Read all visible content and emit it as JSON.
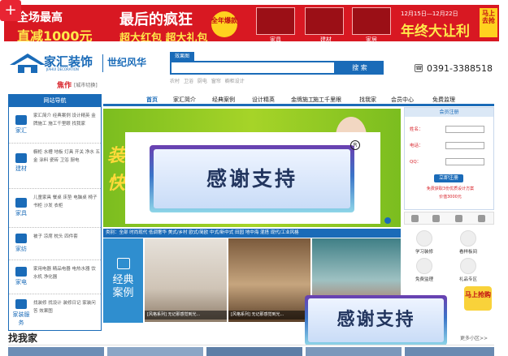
{
  "banner": {
    "left_line1": "全场最高",
    "left_line2": "直减1000元",
    "mid_line1": "最后的疯狂",
    "mid_line2": "超大红包 超大礼包",
    "badge": "全年爆款",
    "products": [
      "家具",
      "建材",
      "家居"
    ],
    "date_range": "12月15日—12月22日",
    "right_text": "年终大让利",
    "tag": "马上去抢"
  },
  "logo": {
    "name": "家汇装饰",
    "en": "JIAHUI DECORATION",
    "slogan": "世纪风华"
  },
  "focus": {
    "label": "焦作",
    "switch": "[城市切换]"
  },
  "search": {
    "tab": "效果图",
    "placeholder": "",
    "button": "搜 索",
    "hot_words": [
      "农村",
      "卫浴",
      "厨电",
      "窗帘",
      "橱柜设计"
    ]
  },
  "phone": "0391-3388518",
  "sidebar": {
    "title": "网站导航",
    "groups": [
      {
        "cat": "家汇",
        "links": "家汇简介 经典案例 设计精英 金牌施工 施工千里眼 找我家"
      },
      {
        "cat": "建材",
        "links": "橱柜 水槽 地板 灯具 开关 净水 五金 涂料 瓷砖 卫浴 厨电"
      },
      {
        "cat": "家具",
        "links": "儿童家具 餐桌 床垫 电脑桌 椅子 书柜 沙发 衣柜"
      },
      {
        "cat": "家纺",
        "links": "被子 凉席 枕头 四件套"
      },
      {
        "cat": "家电",
        "links": "家用电器 精品电器 电热水器 饮水机 净化器"
      },
      {
        "cat": "家装服务",
        "links": "找装修 找设计 装修日记 家装问答 效果图"
      }
    ]
  },
  "nav": {
    "items": [
      "首页",
      "家汇简介",
      "经典案例",
      "设计精英",
      "金牌施工",
      "施工千里眼",
      "找我家",
      "会员中心",
      "免费监理"
    ],
    "right": "免费监理"
  },
  "hero": {
    "word1": "装",
    "word2": "快"
  },
  "ad_overlay": {
    "text": "感谢支持",
    "reg": "R"
  },
  "region": {
    "text": "类别：全部  时尚现代  低调奢华  美式/乡村  欧式/简欧  中式/新中式  田园  地中海  混搭  现代/工业风格"
  },
  "case": {
    "line1": "经典",
    "line2": "案例"
  },
  "photos": [
    {
      "caption": "[风格系列] 无记那感觉到光..."
    },
    {
      "caption": "[风格系列] 无记那感觉到光..."
    },
    {
      "caption": ""
    }
  ],
  "signup": {
    "title": "会员注册",
    "fields": [
      "姓名：",
      "电话：",
      "QQ："
    ],
    "button": "立即注册",
    "note1": "免费获取3份优质设计方案",
    "note2": "价值3000元"
  },
  "services": [
    {
      "label": "学习装修"
    },
    {
      "label": "看样板间"
    },
    {
      "label": "免费监理"
    },
    {
      "label": "礼品专区"
    }
  ],
  "ad2": {
    "text": "感谢支持",
    "tag": "马上抢购"
  },
  "find": {
    "title": "找我家",
    "more": "更多小区>>"
  },
  "corner": {
    "glyph": "+"
  }
}
